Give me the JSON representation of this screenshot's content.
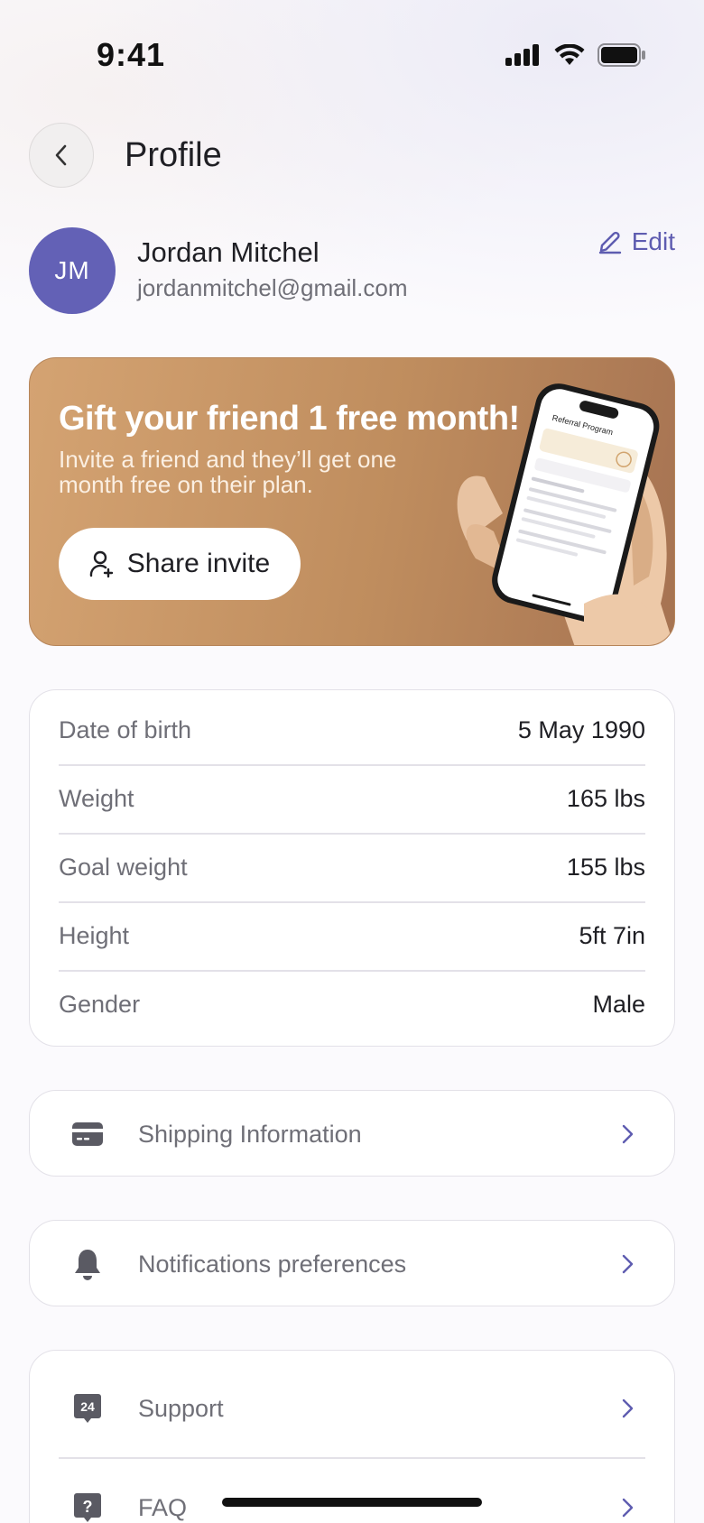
{
  "status_bar": {
    "time": "9:41"
  },
  "header": {
    "title": "Profile"
  },
  "profile": {
    "initials": "JM",
    "name": "Jordan Mitchel",
    "email": "jordanmitchel@gmail.com",
    "edit_label": "Edit"
  },
  "promo": {
    "title": "Gift your friend 1 free month!",
    "subtitle": "Invite a friend and they’ll get one month free on their plan.",
    "button_label": "Share invite",
    "phone_screen_title": "Referral Program"
  },
  "details": [
    {
      "label": "Date of birth",
      "value": "5 May 1990"
    },
    {
      "label": "Weight",
      "value": "165 lbs"
    },
    {
      "label": "Goal weight",
      "value": "155 lbs"
    },
    {
      "label": "Height",
      "value": "5ft 7in"
    },
    {
      "label": "Gender",
      "value": "Male"
    }
  ],
  "menu": {
    "shipping": {
      "label": "Shipping Information",
      "icon": "credit-card-icon"
    },
    "notifications": {
      "label": "Notifications preferences",
      "icon": "bell-icon"
    },
    "support": {
      "label": "Support",
      "icon": "support-24-icon",
      "icon_text": "24"
    },
    "faq": {
      "label": "FAQ",
      "icon": "question-icon",
      "icon_text": "?"
    }
  },
  "colors": {
    "accent": "#5e5cb0",
    "avatar": "#6361b6",
    "promo_start": "#d4a372",
    "promo_end": "#a67352"
  }
}
